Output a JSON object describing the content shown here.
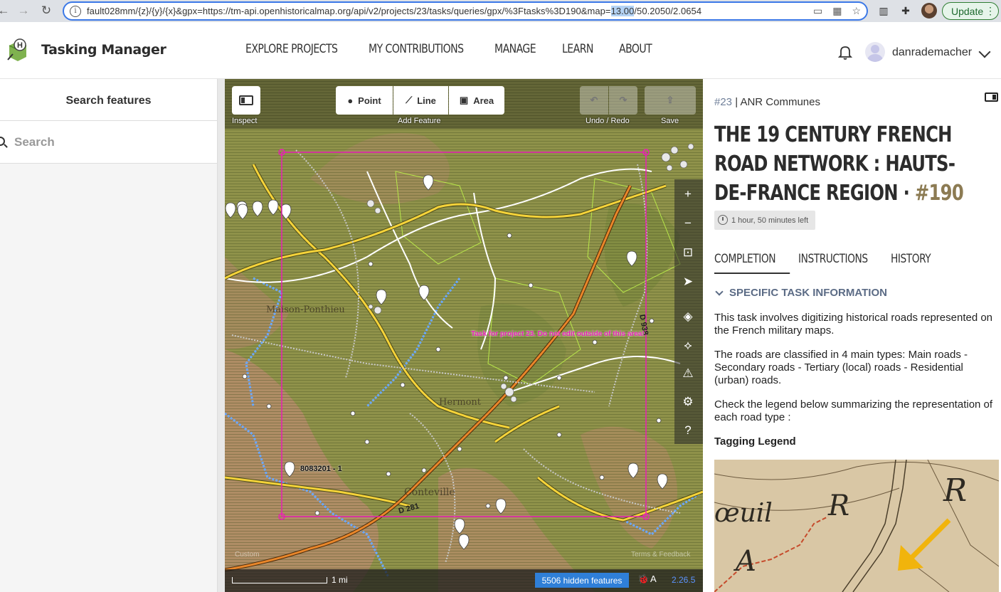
{
  "browser": {
    "url_prefix": "fault028mm/{z}/{y}/{x}&gpx=https://tm-api.openhistoricalmap.org/api/v2/projects/23/tasks/queries/gpx/%3Ftasks%3D190&map=",
    "url_selected": "13.00",
    "url_suffix": "/50.2050/2.0654",
    "update_label": "Update"
  },
  "header": {
    "brand": "Tasking Manager",
    "nav": [
      "EXPLORE PROJECTS",
      "MY CONTRIBUTIONS",
      "MANAGE",
      "LEARN",
      "ABOUT"
    ],
    "username": "danrademacher"
  },
  "search_panel": {
    "title": "Search features",
    "placeholder": "Search"
  },
  "map": {
    "inspect_label": "Inspect",
    "add_feature_label": "Add Feature",
    "point_label": "Point",
    "line_label": "Line",
    "area_label": "Area",
    "undo_redo_label": "Undo / Redo",
    "save_label": "Save",
    "task_boundary_label": "Task for project 23. Do not edit outside of this area!",
    "feature_tag": "8083201 - 1",
    "scale_label": "1 mi",
    "hidden_features": "5506 hidden features",
    "version": "2.26.5",
    "attribution_left": "Custom",
    "attribution_right": "Terms & Feedback",
    "place_labels": [
      "Conteville",
      "Hermont",
      "Maison-Ponthieu",
      "D 281",
      "D 938"
    ]
  },
  "task": {
    "project_id": "#23",
    "project_name": "ANR Communes",
    "title_text": "THE 19 CENTURY FRENCH ROAD NETWORK : HAUTS-DE-FRANCE REGION · ",
    "task_number": "#190",
    "time_left": "1 hour, 50 minutes left",
    "tabs": [
      "COMPLETION",
      "INSTRUCTIONS",
      "HISTORY"
    ],
    "section_title": "SPECIFIC TASK INFORMATION",
    "paragraphs": [
      "This task involves digitizing historical roads represented on the French military maps.",
      "The roads are classified in 4 main types: Main roads - Secondary roads - Tertiary (local) roads - Residential (urban) roads.",
      "Check the legend below summarizing the representation of each road type :"
    ],
    "legend_title": "Tagging Legend",
    "legend_image_text": [
      "œuil",
      "R",
      "R",
      "A"
    ]
  },
  "colors": {
    "accent_link": "#6f7f99",
    "task_number": "#8c7b53",
    "task_boundary": "#e81fb4",
    "primary_road": "#f5d33a",
    "secondary_road": "#e8862a",
    "hidden_features_bg": "#2f7fd8"
  }
}
